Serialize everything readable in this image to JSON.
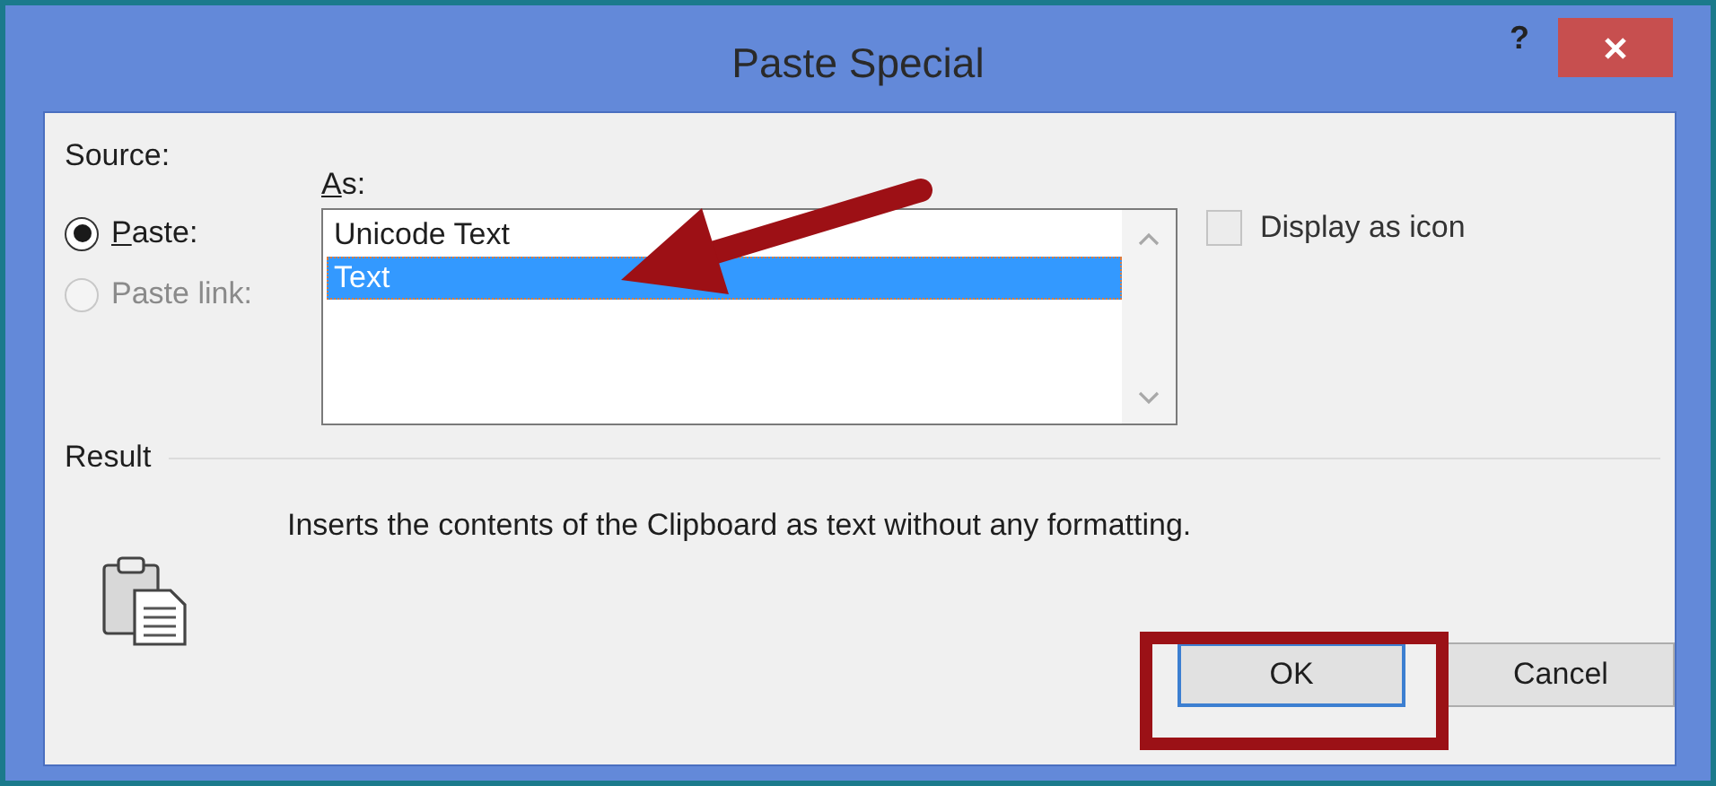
{
  "window": {
    "title": "Paste Special",
    "help": "?"
  },
  "source": {
    "label": "Source:",
    "options": [
      {
        "label": "Paste:",
        "selected": true,
        "disabled": false
      },
      {
        "label": "Paste link:",
        "selected": false,
        "disabled": true
      }
    ]
  },
  "as": {
    "label": "As:",
    "items": [
      {
        "label": "Unicode Text",
        "selected": false
      },
      {
        "label": "Text",
        "selected": true
      }
    ]
  },
  "display_as_icon": {
    "label": "Display as icon",
    "checked": false
  },
  "result": {
    "label": "Result",
    "description": "Inserts the contents of the Clipboard as text without any formatting."
  },
  "buttons": [
    {
      "label": "OK",
      "default": true
    },
    {
      "label": "Cancel",
      "default": false
    }
  ]
}
